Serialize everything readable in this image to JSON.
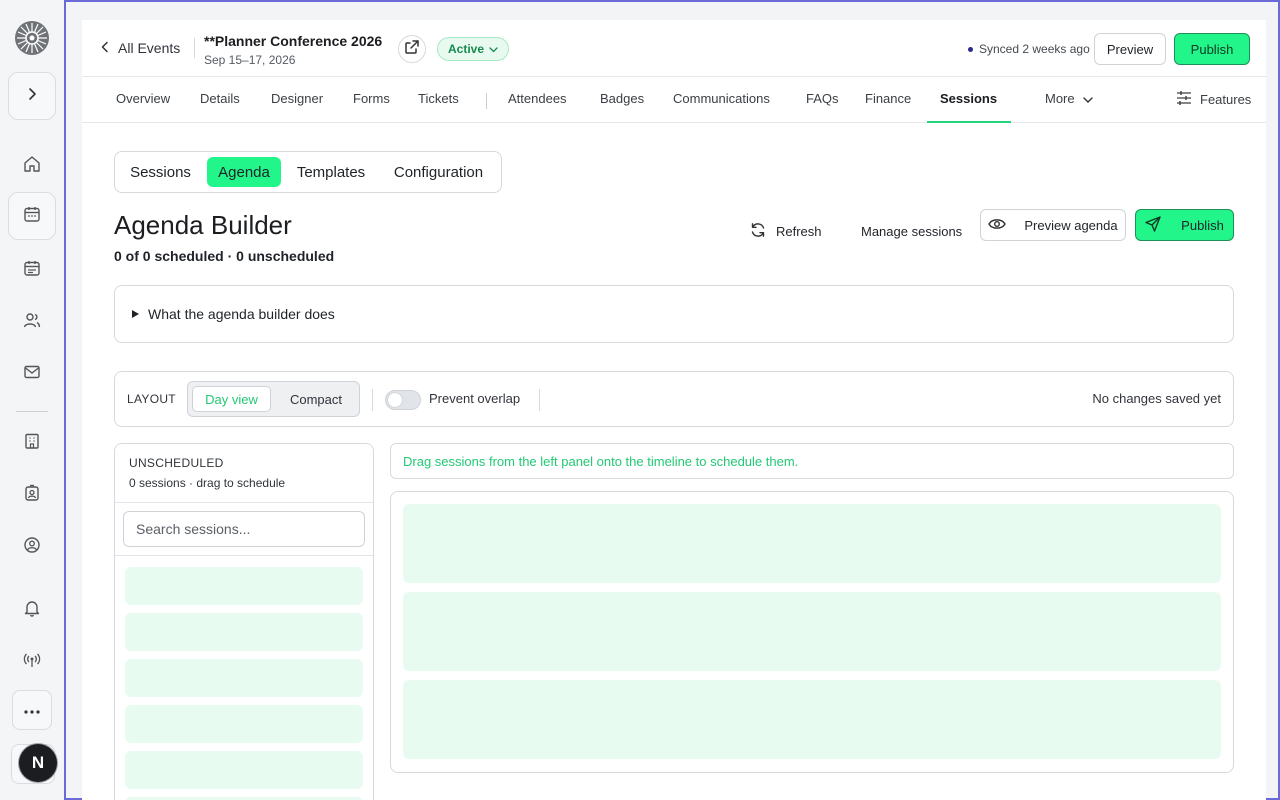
{
  "header": {
    "back_label": "All Events",
    "event_title": "**Planner Conference 2026",
    "event_dates": "Sep 15–17, 2026",
    "status": "Active",
    "sync_status": "Synced 2 weeks ago",
    "preview_label": "Preview",
    "publish_label": "Publish"
  },
  "tabs": [
    {
      "label": "Overview"
    },
    {
      "label": "Details"
    },
    {
      "label": "Designer"
    },
    {
      "label": "Forms"
    },
    {
      "label": "Tickets"
    },
    {
      "label": "Attendees"
    },
    {
      "label": "Badges"
    },
    {
      "label": "Communications"
    },
    {
      "label": "FAQs"
    },
    {
      "label": "Finance"
    },
    {
      "label": "Sessions",
      "active": true
    },
    {
      "label": "More"
    }
  ],
  "features_label": "Features",
  "subtabs": [
    {
      "label": "Sessions"
    },
    {
      "label": "Agenda",
      "active": true
    },
    {
      "label": "Templates"
    },
    {
      "label": "Configuration"
    }
  ],
  "page": {
    "title": "Agenda Builder",
    "counts": "0 of 0 scheduled · 0 unscheduled",
    "refresh_label": "Refresh",
    "manage_label": "Manage sessions",
    "preview_agenda_label": "Preview agenda",
    "publish_label": "Publish",
    "details_summary": "What the agenda builder does"
  },
  "layout_bar": {
    "label": "LAYOUT",
    "options": [
      "Day view",
      "Compact"
    ],
    "selected": "Day view",
    "prevent_overlap_label": "Prevent overlap",
    "prevent_overlap_on": false,
    "save_status": "No changes saved yet"
  },
  "unscheduled": {
    "title": "UNSCHEDULED",
    "subtitle": "0 sessions · drag to schedule",
    "search_placeholder": "Search sessions..."
  },
  "timeline": {
    "hint": "Drag sessions from the left panel onto the timeline to schedule them."
  },
  "user": {
    "initial": "N"
  },
  "colors": {
    "accent": "#22f58a",
    "accent_text": "#22c974",
    "frame_border": "#6a6ad8",
    "skeleton": "#e8fbf1"
  }
}
